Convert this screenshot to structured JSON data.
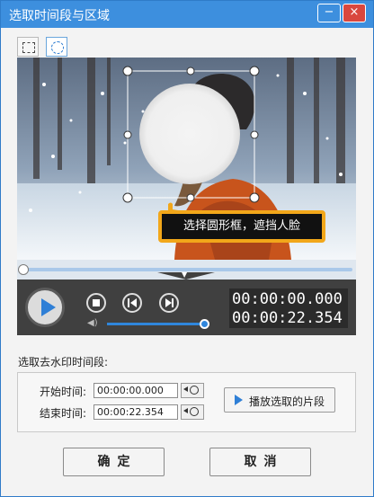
{
  "window": {
    "title": "选取时间段与区域",
    "minimize_label": "−",
    "close_label": "×"
  },
  "shape_tabs": [
    {
      "name": "rectangle",
      "icon": "rectangle-select-icon",
      "active": false
    },
    {
      "name": "ellipse",
      "icon": "ellipse-select-icon",
      "active": true
    }
  ],
  "player": {
    "tooltip": "选择圆形框，遮挡人脸",
    "current_time": "00:00:00.000",
    "total_time": "00:00:22.354",
    "progress": 0.0,
    "volume": 1.0,
    "icons": {
      "play": "play-icon",
      "stop": "stop-icon",
      "prev": "previous-frame-icon",
      "next": "next-frame-icon",
      "volume": "speaker-icon",
      "collapse": "chevron-down-icon"
    }
  },
  "segment": {
    "section_label": "选取去水印时间段:",
    "start_label": "开始时间:",
    "start_value": "00:00:00.000",
    "end_label": "结束时间:",
    "end_value": "00:00:22.354",
    "play_selected_label": "播放选取的片段"
  },
  "buttons": {
    "ok": "确定",
    "cancel": "取消"
  },
  "colors": {
    "titlebar": "#3d8fde",
    "close_button": "#d9473e",
    "accent": "#2f7fd6",
    "tooltip_border": "#f2a71a",
    "player_bg": "#404040"
  }
}
